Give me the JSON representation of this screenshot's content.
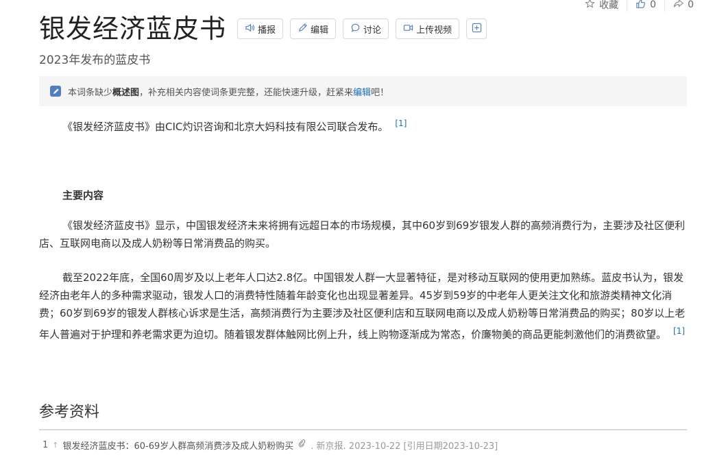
{
  "topbar": {
    "collect": "收藏",
    "like_count": "0",
    "share_count": "0"
  },
  "title": "银发经济蓝皮书",
  "toolbar": {
    "broadcast": "播报",
    "edit": "编辑",
    "discuss": "讨论",
    "upload_video": "上传视频"
  },
  "subtitle": "2023年发布的蓝皮书",
  "notice": {
    "pre": "本词条缺少",
    "bold": "概述图",
    "mid": "，补充相关内容使词条更完整，还能快速升级，赶紧来",
    "link": "编辑",
    "post": "吧！"
  },
  "intro": {
    "text": "《银发经济蓝皮书》由CIC灼识咨询和北京大妈科技有限公司联合发布。",
    "ref": "[1]"
  },
  "section_heading": "主要内容",
  "para1": {
    "text": "《银发经济蓝皮书》显示，中国银发经济未来将拥有远超日本的市场规模，其中60岁到69岁银发人群的高频消费行为，主要涉及社区便利店、互联网电商以及成人奶粉等日常消费品的购买。"
  },
  "para2": {
    "text": "截至2022年底，全国60周岁及以上老年人口达2.8亿。中国银发人群一大显著特征，是对移动互联网的使用更加熟练。蓝皮书认为，银发经济由老年人的多种需求驱动，银发人口的消费特性随着年龄变化也出现显著差异。45岁到59岁的中老年人更关注文化和旅游类精神文化消费；60岁到69岁的银发人群核心诉求是生活，高频消费行为主要涉及社区便利店和互联网电商以及成人奶粉等日常消费品的购买；80岁以上老年人普遍对于护理和养老需求更为迫切。随着银发群体触网比例上升，线上购物逐渐成为常态，价廉物美的商品更能刺激他们的消费欲望。",
    "ref": "[1]"
  },
  "references": {
    "heading": "参考资料",
    "items": [
      {
        "num": "1",
        "up": "↑",
        "title": "银发经济蓝皮书：60-69岁人群高频消费涉及成人奶粉购买",
        "meta": ". 新京报. 2023-10-22 [引用日期2023-10-23]"
      }
    ]
  }
}
